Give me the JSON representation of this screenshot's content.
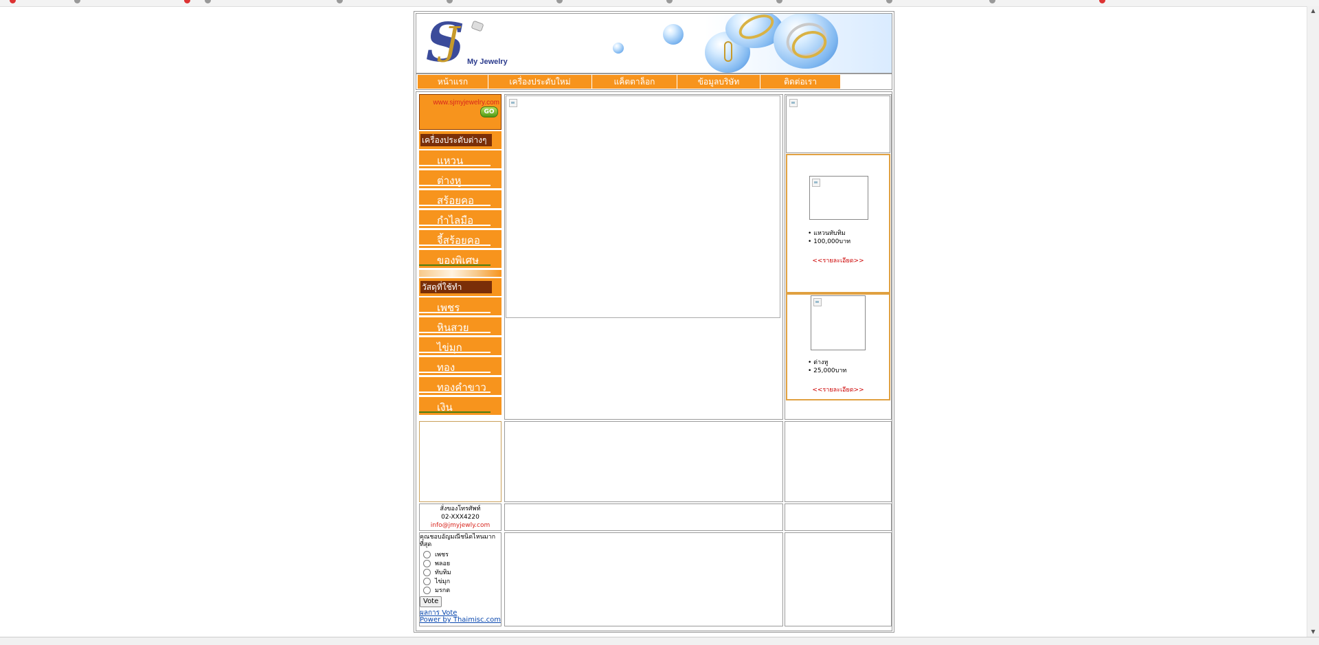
{
  "brand": {
    "logo_text": "My Jewelry",
    "site_url": "www.sjmyjewelry.com",
    "go_label": "GO"
  },
  "nav": {
    "items": [
      "หน้าแรก",
      "เครื่องประดับใหม่",
      "แค็ตตาล็อก",
      "ข้อมูลบริษัท",
      "ติดต่อเรา"
    ]
  },
  "menu": {
    "section1_title": "เครื่องประดับต่างๆ",
    "section1_items": [
      "แหวน",
      "ต่างหู",
      "สร้อยคอ",
      "กำไลมือ",
      "จี้สร้อยคอ",
      "ของพิเศษ"
    ],
    "section2_title": "วัสดุที่ใช้ทำ",
    "section2_items": [
      "เพชร",
      "หินสวย",
      "ไข่มุก",
      "ทอง",
      "ทองคำขาว",
      "เงิน"
    ]
  },
  "products": [
    {
      "name": "แหวนทับทิม",
      "price": "100,000บาท",
      "detail": "<<รายละเอียด>>"
    },
    {
      "name": "ต่างหู",
      "price": "25,000บาท",
      "detail": "<<รายละเอียด>>"
    }
  ],
  "contact": {
    "line1": "สั่งของโทรศัพท์",
    "phone": "02-XXX4220",
    "email": "info@jmyjewly.com"
  },
  "poll": {
    "question": "คุณชอบอัญมณีชนิดไหนมากที่สุด",
    "options": [
      "เพชร",
      "พลอย",
      "ทับทิม",
      "ไข่มุก",
      "มรกต"
    ],
    "vote_label": "Vote",
    "results_link": "ผลการ Vote",
    "powered_link": "Power by Thaimisc.com"
  },
  "colors": {
    "accent_orange": "#f7941d",
    "section_brown": "#7a2e08",
    "detail_red": "#cc0000"
  }
}
